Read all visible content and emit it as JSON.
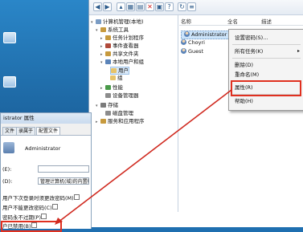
{
  "cm": {
    "toolbar_icons": [
      "back-icon",
      "forward-icon",
      "up-icon",
      "show-tree-icon",
      "export-icon",
      "delete-icon",
      "properties-icon",
      "help-icon",
      "refresh-icon",
      "list-icon"
    ],
    "tree": [
      {
        "label": "计算机管理(本地)",
        "level": 0,
        "icon": "computer-icon"
      },
      {
        "label": "系统工具",
        "level": 1,
        "icon": "tools-icon"
      },
      {
        "label": "任务计划程序",
        "level": 2,
        "icon": "scheduler-icon"
      },
      {
        "label": "事件查看器",
        "level": 2,
        "icon": "event-icon"
      },
      {
        "label": "共享文件夹",
        "level": 2,
        "icon": "share-icon"
      },
      {
        "label": "本地用户和组",
        "level": 2,
        "icon": "users-icon"
      },
      {
        "label": "用户",
        "level": 3,
        "icon": "folder-icon",
        "selected": true
      },
      {
        "label": "组",
        "level": 3,
        "icon": "folder-icon"
      },
      {
        "label": "性能",
        "level": 2,
        "icon": "performance-icon"
      },
      {
        "label": "设备管理器",
        "level": 2,
        "icon": "device-icon"
      },
      {
        "label": "存储",
        "level": 1,
        "icon": "storage-icon"
      },
      {
        "label": "磁盘管理",
        "level": 2,
        "icon": "disk-icon"
      },
      {
        "label": "服务和应用程序",
        "level": 1,
        "icon": "services-icon"
      }
    ],
    "columns": [
      "名称",
      "全名",
      "描述"
    ],
    "users": [
      {
        "name": "Administrator",
        "selected": true
      },
      {
        "name": "Choyri",
        "selected": false
      },
      {
        "name": "Guest",
        "selected": false
      }
    ]
  },
  "context_menu": {
    "items": [
      {
        "label": "设置密码(S)..."
      },
      {
        "label": "所有任务(K)",
        "submenu": true
      },
      {
        "label": "删除(D)"
      },
      {
        "label": "重命名(M)"
      },
      {
        "label": "属性(R)",
        "highlighted": true
      },
      {
        "label": "帮助(H)"
      }
    ]
  },
  "dialog": {
    "title": "istrator 属性",
    "tabs": [
      "文件",
      "录属于",
      "配置文件"
    ],
    "username": "Administrator",
    "fullname_label": "(E):",
    "desc_label": "(D):",
    "desc_value": "管理计算机(域)的内置帐户",
    "options": [
      "用户下次登录时须更改密码(M)",
      "用户不能更改密码(C)",
      "密码永不过期(P)",
      "户已禁用(B)"
    ]
  },
  "colors": {
    "highlight": "#e03020",
    "arrow": "#d02a20"
  }
}
